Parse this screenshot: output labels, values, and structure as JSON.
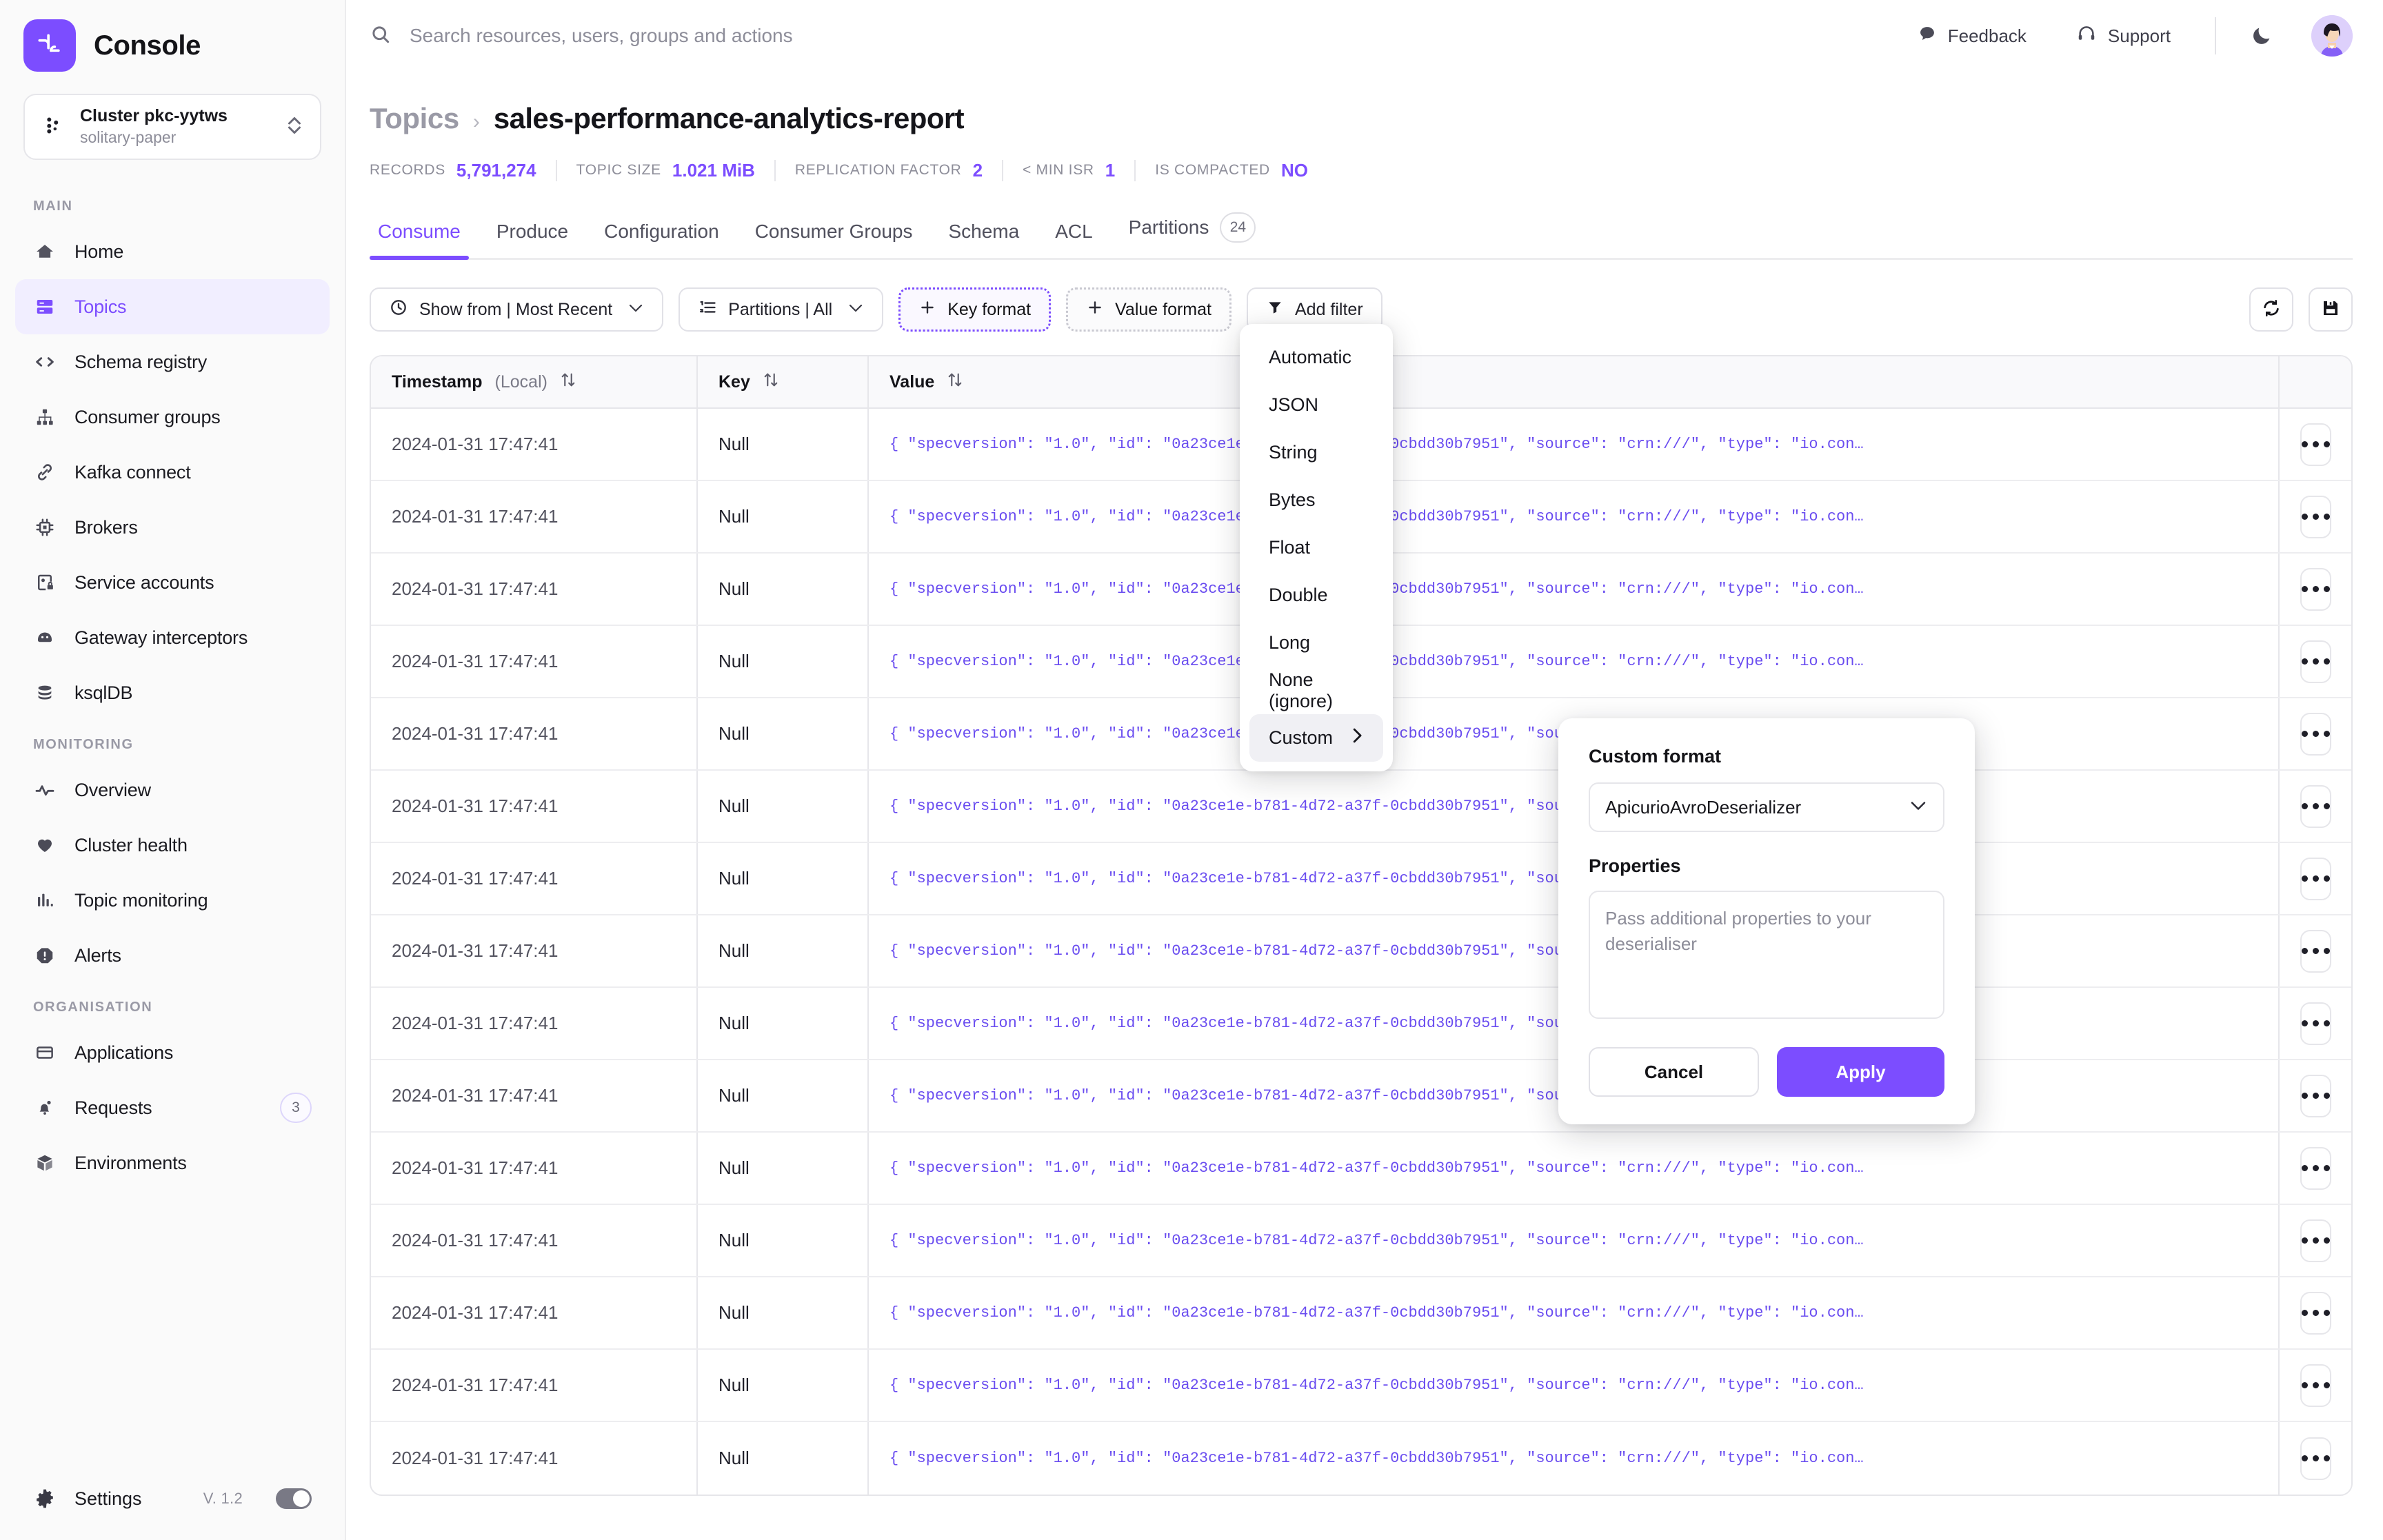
{
  "brand": {
    "name": "Console",
    "logo_icon": "console-logo-icon",
    "accent": "#7c4dff"
  },
  "cluster": {
    "name": "Cluster pkc-yytws",
    "environment": "solitary-paper",
    "icon": "cluster-icon",
    "switch_icon": "chevron-up-down-icon"
  },
  "search": {
    "placeholder": "Search resources, users, groups and actions",
    "value": "",
    "icon": "search-icon"
  },
  "topbar": {
    "feedback_label": "Feedback",
    "feedback_icon": "chat-bubble-icon",
    "support_label": "Support",
    "support_icon": "headset-icon",
    "theme_icon": "moon-icon",
    "avatar_icon": "user-avatar"
  },
  "sidebar": {
    "sections": [
      {
        "title": "MAIN",
        "items": [
          {
            "label": "Home",
            "icon": "home-icon",
            "active": false,
            "badge": ""
          },
          {
            "label": "Topics",
            "icon": "topics-icon",
            "active": true,
            "badge": ""
          },
          {
            "label": "Schema registry",
            "icon": "code-brackets-icon",
            "active": false,
            "badge": ""
          },
          {
            "label": "Consumer groups",
            "icon": "hierarchy-icon",
            "active": false,
            "badge": ""
          },
          {
            "label": "Kafka connect",
            "icon": "link-icon",
            "active": false,
            "badge": ""
          },
          {
            "label": "Brokers",
            "icon": "chip-icon",
            "active": false,
            "badge": ""
          },
          {
            "label": "Service accounts",
            "icon": "service-account-lock-icon",
            "active": false,
            "badge": ""
          },
          {
            "label": "Gateway interceptors",
            "icon": "gateway-icon",
            "active": false,
            "badge": ""
          },
          {
            "label": "ksqlDB",
            "icon": "database-icon",
            "active": false,
            "badge": ""
          }
        ]
      },
      {
        "title": "MONITORING",
        "items": [
          {
            "label": "Overview",
            "icon": "pulse-icon",
            "active": false,
            "badge": ""
          },
          {
            "label": "Cluster health",
            "icon": "heart-icon",
            "active": false,
            "badge": ""
          },
          {
            "label": "Topic monitoring",
            "icon": "bar-chart-icon",
            "active": false,
            "badge": ""
          },
          {
            "label": "Alerts",
            "icon": "alert-octagon-icon",
            "active": false,
            "badge": ""
          }
        ]
      },
      {
        "title": "ORGANISATION",
        "items": [
          {
            "label": "Applications",
            "icon": "window-icon",
            "active": false,
            "badge": ""
          },
          {
            "label": "Requests",
            "icon": "bell-icon",
            "active": false,
            "badge": "3"
          },
          {
            "label": "Environments",
            "icon": "box-icon",
            "active": false,
            "badge": ""
          }
        ]
      }
    ],
    "footer": {
      "settings_label": "Settings",
      "settings_icon": "gear-icon",
      "version": "V. 1.2",
      "toggle_state": "on"
    }
  },
  "breadcrumb": {
    "root": "Topics",
    "separator": "›",
    "current": "sales-performance-analytics-report"
  },
  "metadata": [
    {
      "key": "RECORDS",
      "value": "5,791,274"
    },
    {
      "key": "TOPIC SIZE",
      "value": "1.021 MiB"
    },
    {
      "key": "REPLICATION FACTOR",
      "value": "2"
    },
    {
      "key": "< MIN ISR",
      "value": "1"
    },
    {
      "key": "IS COMPACTED",
      "value": "NO"
    }
  ],
  "tabs": [
    {
      "label": "Consume",
      "active": true,
      "badge": ""
    },
    {
      "label": "Produce",
      "active": false,
      "badge": ""
    },
    {
      "label": "Configuration",
      "active": false,
      "badge": ""
    },
    {
      "label": "Consumer Groups",
      "active": false,
      "badge": ""
    },
    {
      "label": "Schema",
      "active": false,
      "badge": ""
    },
    {
      "label": "ACL",
      "active": false,
      "badge": ""
    },
    {
      "label": "Partitions",
      "active": false,
      "badge": "24"
    }
  ],
  "toolbar": {
    "show_from_label": "Show from | Most Recent",
    "show_from_icon": "clock-icon",
    "partitions_label": "Partitions | All",
    "partitions_icon": "list-ordered-icon",
    "key_format_label": "Key format",
    "value_format_label": "Value format",
    "plus_icon": "plus-icon",
    "add_filter_label": "Add filter",
    "add_filter_icon": "funnel-icon",
    "refresh_icon": "refresh-icon",
    "save_icon": "save-icon",
    "chevron_icon": "chevron-down-icon"
  },
  "table": {
    "columns": [
      {
        "label": "Timestamp",
        "sublabel": "(Local)",
        "sortable": true
      },
      {
        "label": "Key",
        "sublabel": "",
        "sortable": true
      },
      {
        "label": "Value",
        "sublabel": "",
        "sortable": true
      }
    ],
    "sort_icon": "sort-updown-icon",
    "row_action_icon": "ellipsis-icon",
    "rows": [
      {
        "timestamp": "2024-01-31 17:47:41",
        "key": "Null",
        "value": "{  \"specversion\": \"1.0\",  \"id\": \"0a23ce1e-b781-4d72-a37f-0cbdd30b7951\",  \"source\": \"crn:///\",  \"type\": \"io.con…"
      },
      {
        "timestamp": "2024-01-31 17:47:41",
        "key": "Null",
        "value": "{  \"specversion\": \"1.0\",  \"id\": \"0a23ce1e-b781-4d72-a37f-0cbdd30b7951\",  \"source\": \"crn:///\",  \"type\": \"io.con…"
      },
      {
        "timestamp": "2024-01-31 17:47:41",
        "key": "Null",
        "value": "{  \"specversion\": \"1.0\",  \"id\": \"0a23ce1e-b781-4d72-a37f-0cbdd30b7951\",  \"source\": \"crn:///\",  \"type\": \"io.con…"
      },
      {
        "timestamp": "2024-01-31 17:47:41",
        "key": "Null",
        "value": "{  \"specversion\": \"1.0\",  \"id\": \"0a23ce1e-b781-4d72-a37f-0cbdd30b7951\",  \"source\": \"crn:///\",  \"type\": \"io.con…"
      },
      {
        "timestamp": "2024-01-31 17:47:41",
        "key": "Null",
        "value": "{  \"specversion\": \"1.0\",  \"id\": \"0a23ce1e-b781-4d72-a37f-0cbdd30b7951\",  \"source\": \"crn:///\",  \"type\": \"io.con…"
      },
      {
        "timestamp": "2024-01-31 17:47:41",
        "key": "Null",
        "value": "{  \"specversion\": \"1.0\",  \"id\": \"0a23ce1e-b781-4d72-a37f-0cbdd30b7951\",  \"source\": \"crn:///\",  \"type\": \"io.con…"
      },
      {
        "timestamp": "2024-01-31 17:47:41",
        "key": "Null",
        "value": "{  \"specversion\": \"1.0\",  \"id\": \"0a23ce1e-b781-4d72-a37f-0cbdd30b7951\",  \"source\": \"crn:///\",  \"type\": \"io.con…"
      },
      {
        "timestamp": "2024-01-31 17:47:41",
        "key": "Null",
        "value": "{  \"specversion\": \"1.0\",  \"id\": \"0a23ce1e-b781-4d72-a37f-0cbdd30b7951\",  \"source\": \"crn:///\",  \"type\": \"io.con…"
      },
      {
        "timestamp": "2024-01-31 17:47:41",
        "key": "Null",
        "value": "{  \"specversion\": \"1.0\",  \"id\": \"0a23ce1e-b781-4d72-a37f-0cbdd30b7951\",  \"source\": \"crn:///\",  \"type\": \"io.con…"
      },
      {
        "timestamp": "2024-01-31 17:47:41",
        "key": "Null",
        "value": "{  \"specversion\": \"1.0\",  \"id\": \"0a23ce1e-b781-4d72-a37f-0cbdd30b7951\",  \"source\": \"crn:///\",  \"type\": \"io.con…"
      },
      {
        "timestamp": "2024-01-31 17:47:41",
        "key": "Null",
        "value": "{  \"specversion\": \"1.0\",  \"id\": \"0a23ce1e-b781-4d72-a37f-0cbdd30b7951\",  \"source\": \"crn:///\",  \"type\": \"io.con…"
      },
      {
        "timestamp": "2024-01-31 17:47:41",
        "key": "Null",
        "value": "{  \"specversion\": \"1.0\",  \"id\": \"0a23ce1e-b781-4d72-a37f-0cbdd30b7951\",  \"source\": \"crn:///\",  \"type\": \"io.con…"
      },
      {
        "timestamp": "2024-01-31 17:47:41",
        "key": "Null",
        "value": "{  \"specversion\": \"1.0\",  \"id\": \"0a23ce1e-b781-4d72-a37f-0cbdd30b7951\",  \"source\": \"crn:///\",  \"type\": \"io.con…"
      },
      {
        "timestamp": "2024-01-31 17:47:41",
        "key": "Null",
        "value": "{  \"specversion\": \"1.0\",  \"id\": \"0a23ce1e-b781-4d72-a37f-0cbdd30b7951\",  \"source\": \"crn:///\",  \"type\": \"io.con…"
      },
      {
        "timestamp": "2024-01-31 17:47:41",
        "key": "Null",
        "value": "{  \"specversion\": \"1.0\",  \"id\": \"0a23ce1e-b781-4d72-a37f-0cbdd30b7951\",  \"source\": \"crn:///\",  \"type\": \"io.con…"
      }
    ]
  },
  "key_format_menu": {
    "items": [
      {
        "label": "Automatic",
        "has_submenu": false,
        "highlighted": false
      },
      {
        "label": "JSON",
        "has_submenu": false,
        "highlighted": false
      },
      {
        "label": "String",
        "has_submenu": false,
        "highlighted": false
      },
      {
        "label": "Bytes",
        "has_submenu": false,
        "highlighted": false
      },
      {
        "label": "Float",
        "has_submenu": false,
        "highlighted": false
      },
      {
        "label": "Double",
        "has_submenu": false,
        "highlighted": false
      },
      {
        "label": "Long",
        "has_submenu": false,
        "highlighted": false
      },
      {
        "label": "None (ignore)",
        "has_submenu": false,
        "highlighted": false
      },
      {
        "label": "Custom",
        "has_submenu": true,
        "highlighted": true
      }
    ],
    "submenu_arrow_icon": "chevron-right-icon"
  },
  "custom_format_panel": {
    "title": "Custom format",
    "select_value": "ApicurioAvroDeserializer",
    "select_chevron_icon": "chevron-down-icon",
    "properties_label": "Properties",
    "properties_placeholder": "Pass additional properties to your deserialiser",
    "properties_value": "",
    "cancel_label": "Cancel",
    "apply_label": "Apply"
  }
}
